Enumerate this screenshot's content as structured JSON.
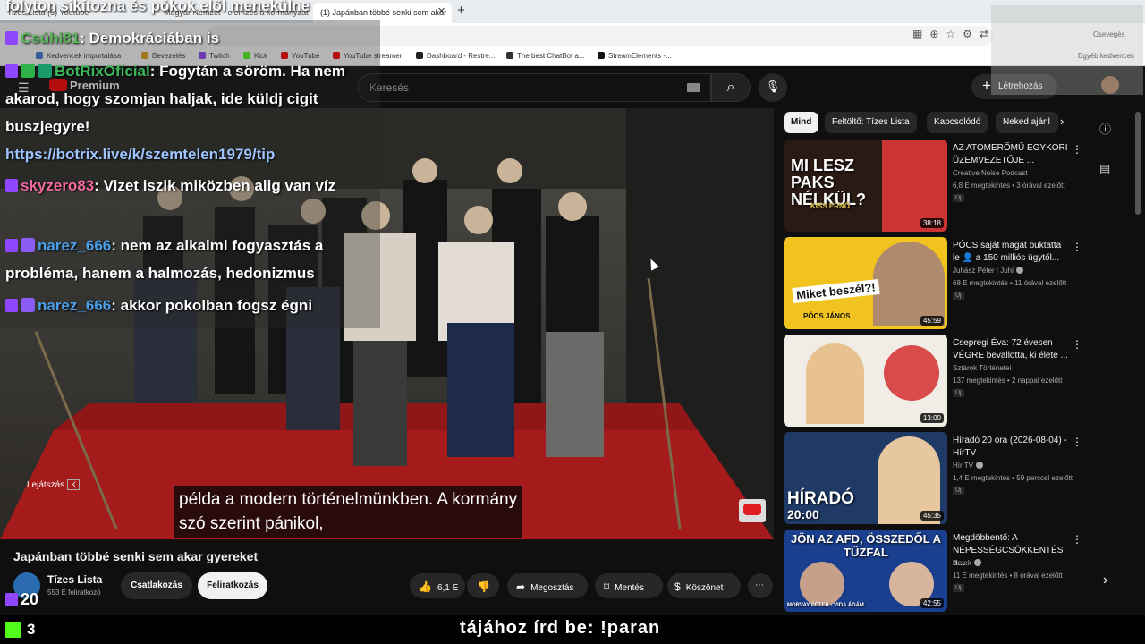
{
  "browser": {
    "tabs": [
      {
        "label": "Tizes Lista (5) Youtube",
        "active": false
      },
      {
        "label": "Magyar Nemzet · elemzés a kormányzati végjáték",
        "active": false
      },
      {
        "label": "(1) Japánban többé senki sem akar",
        "active": true
      }
    ],
    "tab_close": "✕",
    "tab_new": "+",
    "profile_label": "Csevegés",
    "bookmarks": [
      {
        "label": "Kedvencek importálása",
        "color": "#3d7ad6"
      },
      {
        "label": "Bevezetés",
        "color": "#e0a31e"
      },
      {
        "label": "Twitch",
        "color": "#9146ff"
      },
      {
        "label": "Kick",
        "color": "#53fc18"
      },
      {
        "label": "YouTube",
        "color": "#ff0000"
      },
      {
        "label": "YouTube streamer",
        "color": "#ff0000"
      },
      {
        "label": "Dashboard - Restre...",
        "color": "#222222"
      },
      {
        "label": "The best ChatBot a...",
        "color": "#333333"
      },
      {
        "label": "StreamElements -...",
        "color": "#111111"
      }
    ],
    "bookmarks_right": "Egyéb kedvencek"
  },
  "youtube": {
    "logo_text": "Premium",
    "search_placeholder": "Keresés",
    "search_icon": "search-icon",
    "create_label": "Létrehozás",
    "video_title": "Japánban többé senki sem akar gyereket",
    "channel_name": "Tízes Lista",
    "channel_subs": "553 E feliratkozó",
    "join_label": "Csatlakozás",
    "subscribe_label": "Feliratkozás",
    "likes": "6,1 E",
    "share_label": "Megosztás",
    "save_label": "Mentés",
    "thanks_label": "Köszönet",
    "more_label": "⋯",
    "subtitle_line1": "példa a modern történelmünkben. A kormány",
    "subtitle_line2": "szó szerint pánikol,",
    "skip_label": "Lejátszás",
    "skip_key": "K"
  },
  "sidebar": {
    "chips": [
      "Mind",
      "Feltöltő: Tízes Lista",
      "Kapcsolódó",
      "Neked ajánl"
    ],
    "recommendations": [
      {
        "title": "AZ ATOMERŐMŰ EGYKORI ÜZEMVEZETŐJE ...",
        "channel": "Creative Noise Podcast",
        "meta": "6,8 E megtekintés • 3 órával ezelőtt",
        "badge": "Új",
        "duration": "38:18",
        "thumb_text": "MI LESZ PAKS NÉLKÜL?",
        "thumb_sub": "KISS ERNŐ",
        "verified": false
      },
      {
        "title": "PÓCS saját magát buktatta le 👤 a 150 milliós ügytől...",
        "channel": "Juhász Péter | Juhi",
        "meta": "68 E megtekintés • 11 órával ezelőtt",
        "badge": "Új",
        "duration": "45:59",
        "thumb_text": "Miket beszél?!",
        "thumb_sub": "PÓCS JÁNOS",
        "verified": true
      },
      {
        "title": "Csepregi Éva: 72 évesen VÉGRE bevallotta, ki élete ...",
        "channel": "Sztárok Történetei",
        "meta": "137 megtekintés • 2 nappal ezelőtt",
        "badge": "Új",
        "duration": "13:00",
        "thumb_text": "",
        "thumb_sub": "",
        "verified": false
      },
      {
        "title": "Híradó 20 óra (2026-08-04) - HírTV",
        "channel": "Hír TV",
        "meta": "1,4 E megtekintés • 59 perccel ezelőtt",
        "badge": "Új",
        "duration": "45:35",
        "thumb_text": "HÍRADÓ",
        "thumb_sub": "20:00",
        "verified": true
      },
      {
        "title": "Megdöbbentő: A NÉPESSÉGCSÖKKENTÉS a...",
        "channel": "Hetek",
        "meta": "11 E megtekintés • 8 órával ezelőtt",
        "badge": "Új",
        "duration": "42:55",
        "thumb_text": "JÖN AZ AFD, ÖSSZEDŐL A TŰZFAL",
        "thumb_sub": "MORVAY PÉTER · VIDA ÁDÁM",
        "verified": true
      }
    ]
  },
  "chat": {
    "top_line": "folyton sikítozna és pókok elől menekülne",
    "messages": [
      {
        "user": "Csúhi81",
        "text": ": Demokráciában is",
        "color": "lime"
      },
      {
        "user": "BotRixOficial",
        "text": ": Fogytán a söröm. Ha nem akarod, hogy szomjan haljak, ide küldj cigit buszjegyre!",
        "link": "https://botrix.live/k/szemtelen1979/tip",
        "color": "green"
      },
      {
        "user": "skyzero83",
        "text": ": Vizet iszik miközben alig van víz",
        "color": "pink"
      },
      {
        "user": "narez_666",
        "text": ": nem az alkalmi fogyasztás a probléma, hanem a halmozás, hedonizmus",
        "color": "blue"
      },
      {
        "user": "narez_666",
        "text": ": akkor pokolban fogsz égni",
        "color": "blue"
      }
    ]
  },
  "stream_overlay": {
    "twitch_viewers": "20",
    "kick_viewers": "3",
    "ticker_text": "tájához írd be: !paran"
  },
  "colors": {
    "yt_background": "#0f0f0f",
    "twitch": "#9146ff",
    "kick": "#53fc18",
    "yt_red": "#ff0000"
  }
}
